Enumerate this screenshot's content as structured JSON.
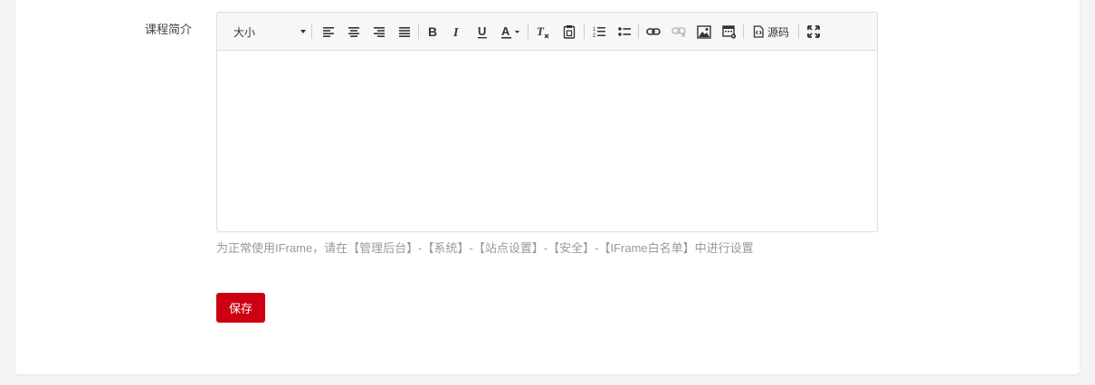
{
  "form": {
    "field_label": "课程简介",
    "hint": "为正常使用IFrame，请在【管理后台】-【系统】-【站点设置】-【安全】-【IFrame白名单】中进行设置",
    "save_label": "保存"
  },
  "toolbar": {
    "font_size_value": "大小",
    "source_label": "源码",
    "icons": [
      "align-left-icon",
      "align-center-icon",
      "align-right-icon",
      "align-justify-icon",
      "bold-icon",
      "italic-icon",
      "underline-icon",
      "font-color-icon",
      "remove-format-icon",
      "paste-text-icon",
      "ordered-list-icon",
      "unordered-list-icon",
      "link-icon",
      "unlink-icon",
      "image-icon",
      "media-icon",
      "source-icon",
      "maximize-icon"
    ]
  },
  "colors": {
    "accent": "#cc0011",
    "hint_text": "#999999",
    "border": "#dddddd",
    "page_bg": "#f4f4f4"
  }
}
